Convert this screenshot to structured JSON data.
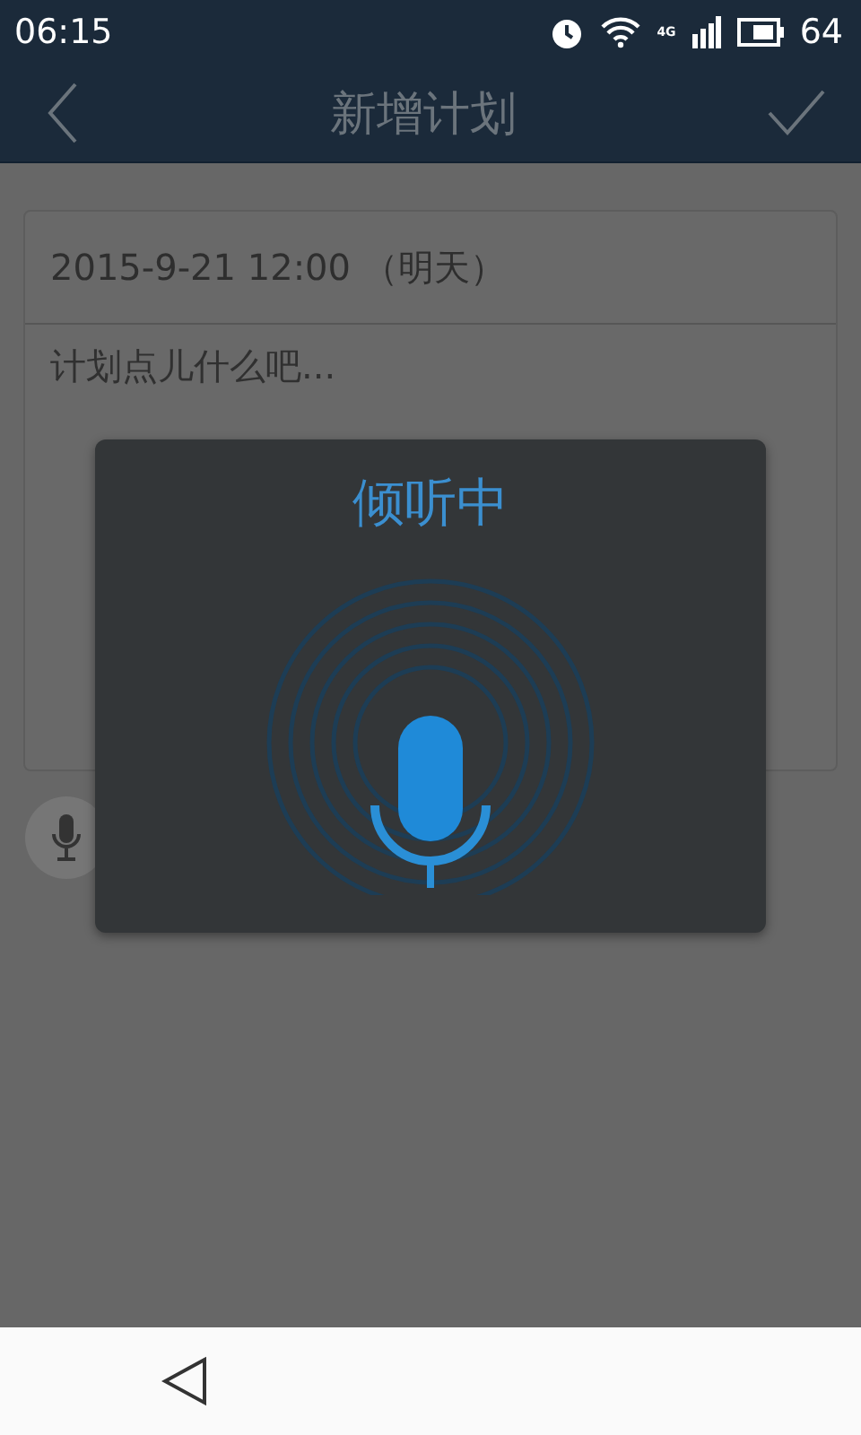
{
  "status_bar": {
    "time": "06:15",
    "network": "4G",
    "battery": "64"
  },
  "header": {
    "title": "新增计划"
  },
  "plan": {
    "date": "2015-9-21 12:00 （明天）",
    "placeholder": "计划点儿什么吧..."
  },
  "voice_dialog": {
    "title": "倾听中"
  }
}
